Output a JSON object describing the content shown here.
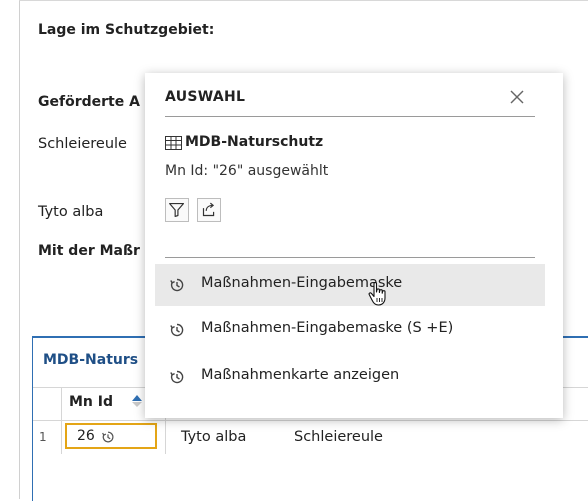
{
  "form": {
    "location_label": "Lage im Schutzgebiet:",
    "promoted_label": "Geförderte A",
    "species_common": "Schleiereule",
    "species_latin": "Tyto alba",
    "measure_label": "Mit der Maßr"
  },
  "table": {
    "title": "MDB-Naturs",
    "column_header": "Mn Id",
    "rows": [
      {
        "num": "1",
        "id": "26",
        "latin": "Tyto alba",
        "common": "Schleiereule"
      }
    ]
  },
  "popup": {
    "title": "AUSWAHL",
    "layer_name": "MDB-Naturschutz",
    "selection_info": "Mn Id: \"26\" ausgewählt",
    "menu_items": [
      {
        "label": "Maßnahmen-Eingabemaske",
        "highlighted": true
      },
      {
        "label": "Maßnahmen-Eingabemaske (S +E)",
        "highlighted": false
      },
      {
        "label": "Maßnahmenkarte anzeigen",
        "highlighted": false
      }
    ]
  },
  "colors": {
    "accent_blue": "#2f6fb3",
    "cell_highlight": "#e4a516",
    "menu_highlight": "#e9e9e9"
  },
  "icons": {
    "close": "close-icon",
    "table": "table-icon",
    "filter": "filter-icon",
    "export": "export-icon",
    "menu": "clock-arrow-icon",
    "cursor": "hand-pointer-icon"
  }
}
